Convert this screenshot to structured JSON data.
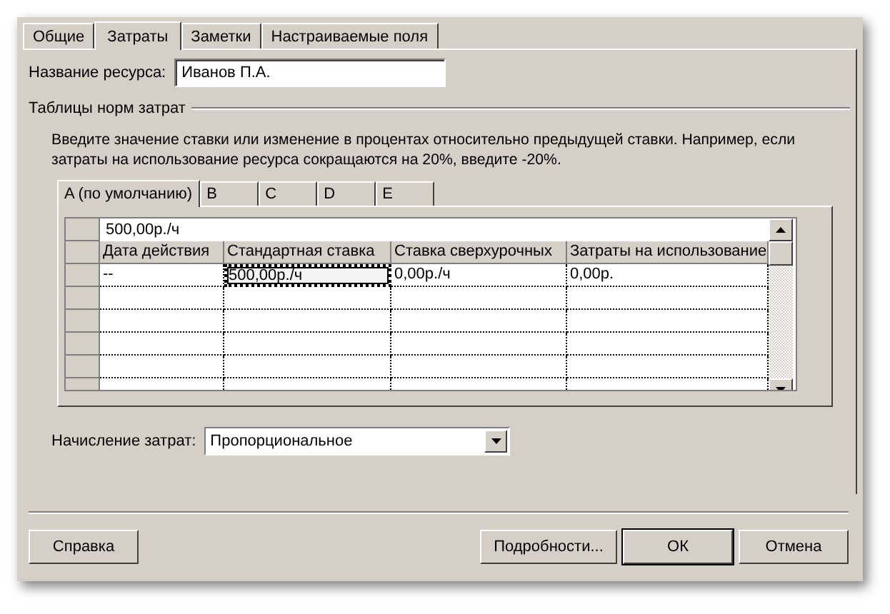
{
  "tabs": [
    {
      "label": "Общие",
      "selected": false
    },
    {
      "label": "Затраты",
      "selected": true
    },
    {
      "label": "Заметки",
      "selected": false
    },
    {
      "label": "Настраиваемые поля",
      "selected": false
    }
  ],
  "resource_name": {
    "label": "Название ресурса:",
    "value": "Иванов П.А."
  },
  "rate_tables": {
    "title": "Таблицы норм затрат",
    "hint": "Введите значение ставки или изменение в процентах относительно предыдущей ставки. Например, если затраты на использование ресурса сокращаются на 20%, введите -20%.",
    "tabs": [
      {
        "label": "A (по умолчанию)",
        "selected": true
      },
      {
        "label": "B",
        "selected": false
      },
      {
        "label": "C",
        "selected": false
      },
      {
        "label": "D",
        "selected": false
      },
      {
        "label": "E",
        "selected": false
      }
    ],
    "edit_bar": "500,00р./ч",
    "columns": [
      "Дата действия",
      "Стандартная ставка",
      "Ставка сверхурочных",
      "Затраты на использование"
    ],
    "rows": [
      {
        "cells": [
          {
            "text": "--",
            "selected": false
          },
          {
            "text": "500,00р./ч",
            "selected": true
          },
          {
            "text": "0,00р./ч",
            "selected": false
          },
          {
            "text": "0,00р.",
            "selected": false
          }
        ]
      }
    ]
  },
  "cost_accrual": {
    "label": "Начисление затрат:",
    "value": "Пропорциональное"
  },
  "buttons": [
    {
      "label": "Справка",
      "kind": "help",
      "default": false
    },
    {
      "label": "Подробности...",
      "kind": "action",
      "default": false
    },
    {
      "label": "ОК",
      "kind": "action",
      "default": true
    },
    {
      "label": "Отмена",
      "kind": "action",
      "default": false
    }
  ]
}
